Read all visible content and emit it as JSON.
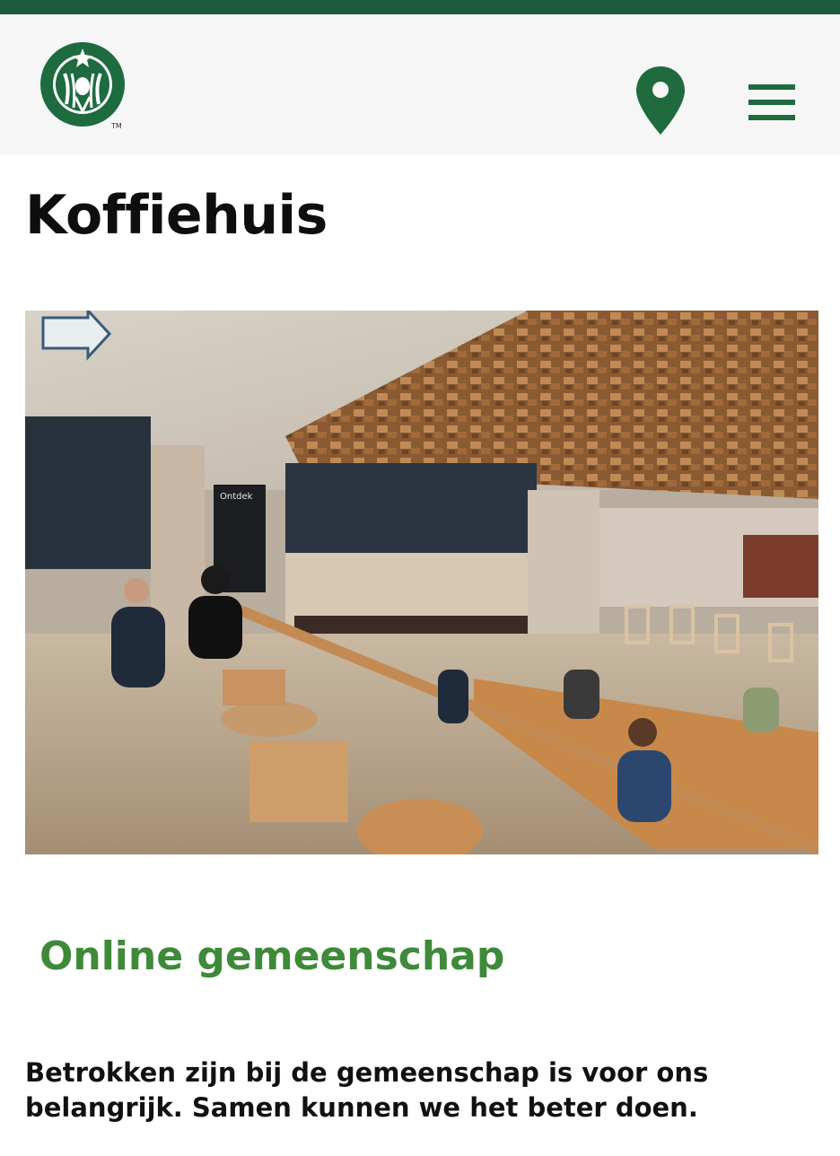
{
  "header": {
    "logo_icon": "starbucks-siren-logo",
    "location_icon": "map-pin-icon",
    "menu_icon": "hamburger-menu-icon",
    "brand_color": "#1e5b3c",
    "icon_color": "#1f6b3e"
  },
  "page": {
    "title": "Koffiehuis"
  },
  "hero": {
    "sign_text": "Ontdek"
  },
  "section": {
    "title": "Online gemeenschap",
    "title_color": "#3f8a3a",
    "body": "Betrokken zijn bij de gemeenschap is voor ons belangrijk. Samen kunnen we het beter doen."
  }
}
